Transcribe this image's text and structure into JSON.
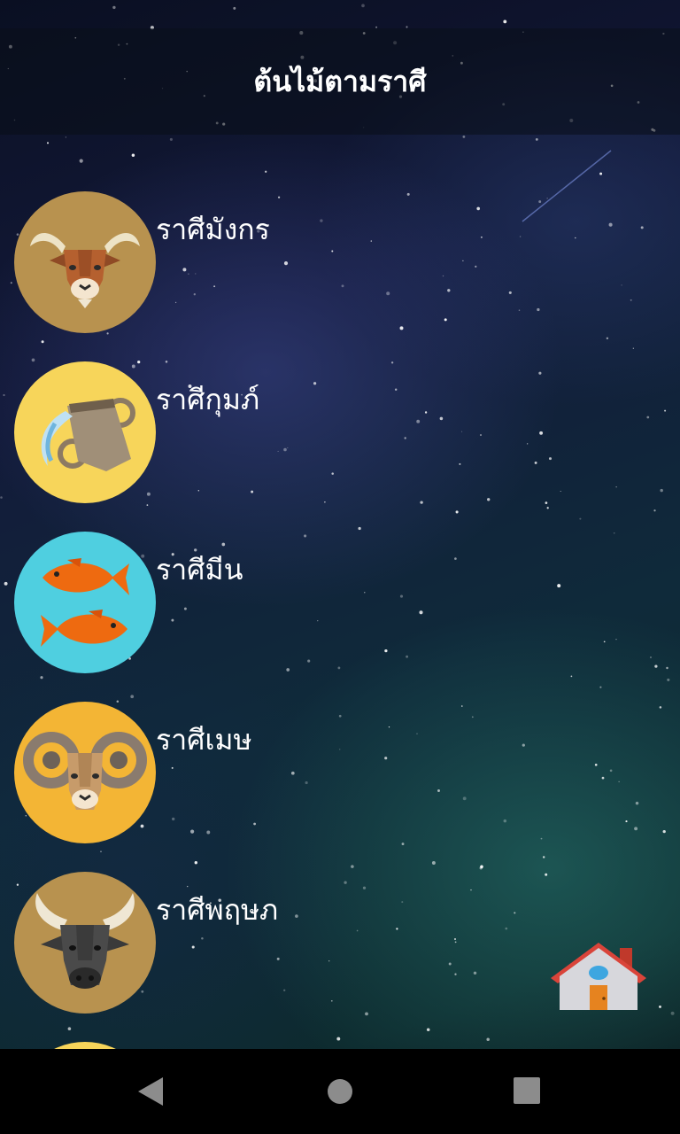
{
  "app": {
    "title": "ต้นไม้ตามราศี"
  },
  "zodiac_list": [
    {
      "label": "ราศีมังกร",
      "icon": "capricorn-goat-icon",
      "bg": "#b8924f"
    },
    {
      "label": "ราศีกุมภ์",
      "icon": "aquarius-jug-icon",
      "bg": "#f7d55a"
    },
    {
      "label": "ราศีมีน",
      "icon": "pisces-fish-icon",
      "bg": "#4fcfe0"
    },
    {
      "label": "ราศีเมษ",
      "icon": "aries-ram-icon",
      "bg": "#f3b535"
    },
    {
      "label": "ราศีพฤษภ",
      "icon": "taurus-bull-icon",
      "bg": "#b8924f"
    },
    {
      "label": "",
      "icon": "next-sign-icon",
      "bg": "#f7d55a"
    }
  ],
  "home_button": {
    "icon": "home-house-icon"
  },
  "nav": {
    "back": "back-triangle-icon",
    "home": "home-circle-icon",
    "recents": "recents-square-icon"
  },
  "colors": {
    "header_bg": "#0a0e18",
    "text": "#ffffff",
    "nav_bg": "#000000"
  }
}
